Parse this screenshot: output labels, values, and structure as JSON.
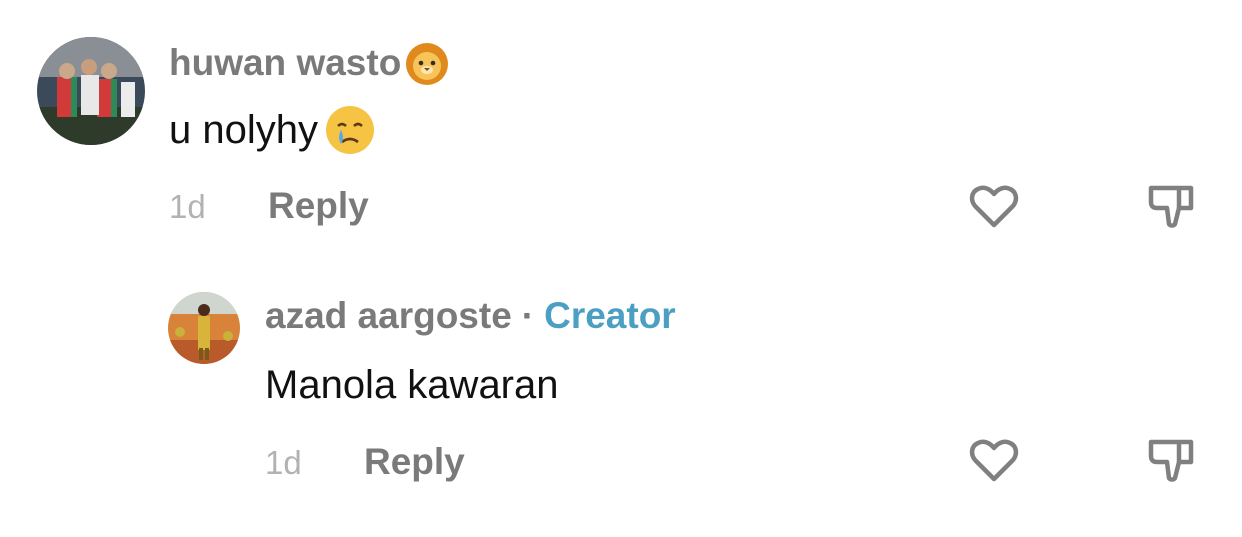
{
  "comments": [
    {
      "username": "huwan wasto",
      "username_emoji": "lion-face",
      "text": "u nolyhy",
      "text_emoji": "crying-face",
      "time": "1d",
      "reply_label": "Reply",
      "like_icon": "heart-outline-icon",
      "dislike_icon": "thumbs-down-outline-icon"
    },
    {
      "username": "azad aargoste",
      "separator": "·",
      "badge": "Creator",
      "text": "Manola kawaran",
      "time": "1d",
      "reply_label": "Reply",
      "like_icon": "heart-outline-icon",
      "dislike_icon": "thumbs-down-outline-icon"
    }
  ],
  "colors": {
    "username": "#7a7a7a",
    "text": "#111111",
    "time": "#b2b2b2",
    "creator": "#4a9fc2",
    "icon": "#808080"
  }
}
